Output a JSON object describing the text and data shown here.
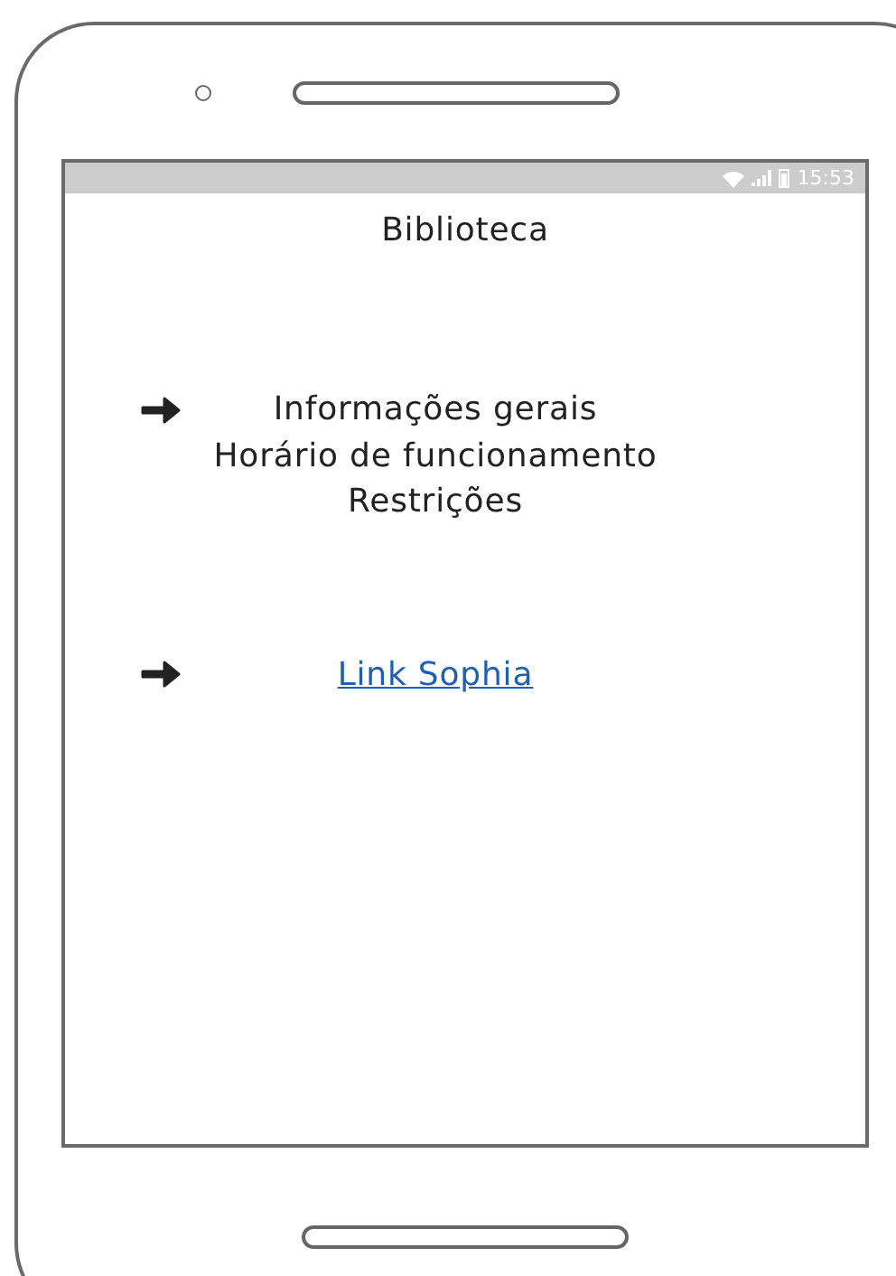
{
  "status_bar": {
    "time": "15:53"
  },
  "title": "Biblioteca",
  "items": [
    {
      "kind": "text",
      "label": "Informações gerais",
      "arrow": true
    },
    {
      "kind": "text",
      "label": "Horário de funcionamento",
      "arrow": false
    },
    {
      "kind": "text",
      "label": "Restrições",
      "arrow": false
    },
    {
      "kind": "link",
      "label": "Link Sophia",
      "arrow": true
    }
  ]
}
